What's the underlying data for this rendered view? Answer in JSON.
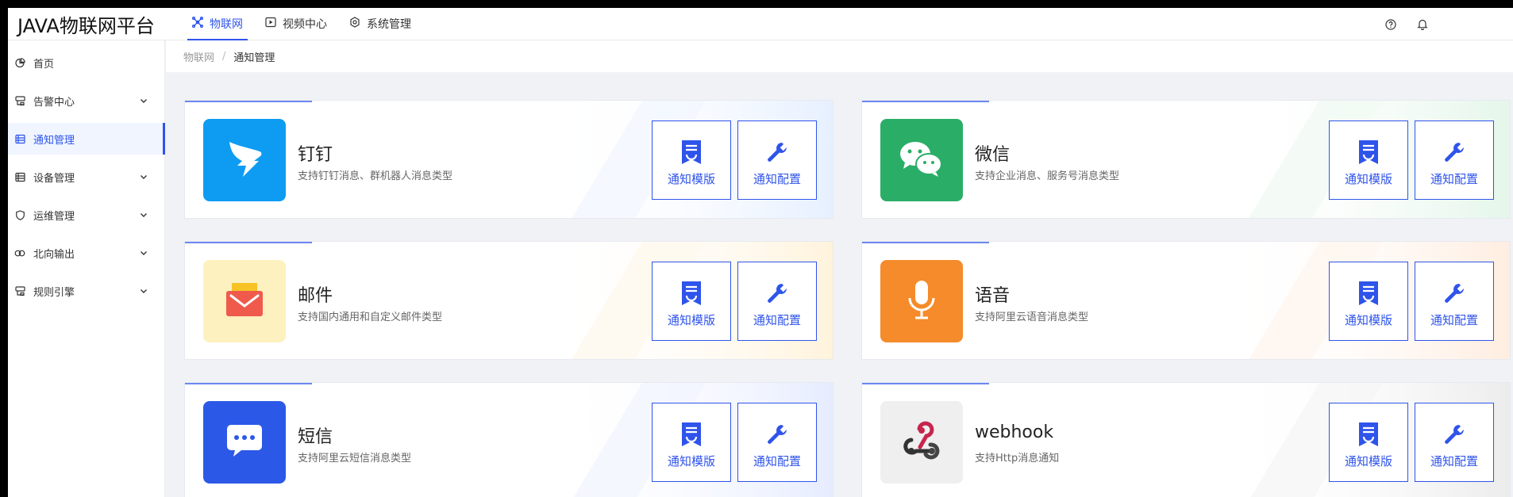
{
  "app": {
    "title": "JAVA物联网平台"
  },
  "top_nav": [
    {
      "label": "物联网",
      "icon": "iot-icon",
      "active": true
    },
    {
      "label": "视频中心",
      "icon": "video-play-icon",
      "active": false
    },
    {
      "label": "系统管理",
      "icon": "system-settings-icon",
      "active": false
    }
  ],
  "header_icons": [
    "help-icon",
    "bell-icon"
  ],
  "sidebar": {
    "items": [
      {
        "label": "首页",
        "icon": "home-pie-icon",
        "has_children": false,
        "active": false
      },
      {
        "label": "告警中心",
        "icon": "alarm-icon",
        "has_children": true,
        "active": false
      },
      {
        "label": "通知管理",
        "icon": "notify-list-icon",
        "has_children": false,
        "active": true
      },
      {
        "label": "设备管理",
        "icon": "device-list-icon",
        "has_children": true,
        "active": false
      },
      {
        "label": "运维管理",
        "icon": "ops-shield-icon",
        "has_children": true,
        "active": false
      },
      {
        "label": "北向输出",
        "icon": "northbound-icon",
        "has_children": true,
        "active": false
      },
      {
        "label": "规则引擎",
        "icon": "rule-engine-icon",
        "has_children": true,
        "active": false
      }
    ]
  },
  "breadcrumb": {
    "parent": "物联网",
    "separator": "/",
    "current": "通知管理"
  },
  "cards": [
    {
      "title": "钉钉",
      "desc": "支持钉钉消息、群机器人消息类型",
      "icon": "dingtalk-icon",
      "logo_bg": "#0e9cf3"
    },
    {
      "title": "微信",
      "desc": "支持企业消息、服务号消息类型",
      "icon": "wechat-icon",
      "logo_bg": "#2aae67"
    },
    {
      "title": "邮件",
      "desc": "支持国内通用和自定义邮件类型",
      "icon": "email-icon",
      "logo_bg": "#fdf1c0"
    },
    {
      "title": "语音",
      "desc": "支持阿里云语音消息类型",
      "icon": "microphone-icon",
      "logo_bg": "#f58b2a"
    },
    {
      "title": "短信",
      "desc": "支持阿里云短信消息类型",
      "icon": "sms-chat-icon",
      "logo_bg": "#2c58e8"
    },
    {
      "title": "webhook",
      "desc": "支持Http消息通知",
      "icon": "webhook-icon",
      "logo_bg": "#efefef"
    }
  ],
  "actions": {
    "template_label": "通知模版",
    "config_label": "通知配置"
  },
  "colors": {
    "accent": "#2f54eb",
    "background": "#f0f2f5"
  }
}
